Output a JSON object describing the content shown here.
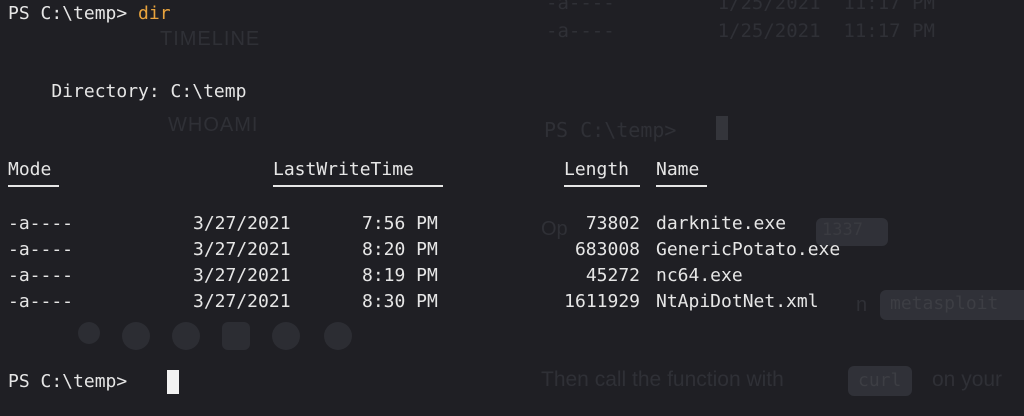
{
  "ghost": {
    "top_row_1": "-a----         1/25/2021  11:17 PM",
    "top_row_2": "-a----         1/25/2021  11:17 PM",
    "timeline": "TIMELINE",
    "whoami": "WHOAMI",
    "prompt": "PS C:\\temp>",
    "op_fragment": "Op",
    "num_fragment": "1337",
    "n_fragment": "n",
    "code_fragment": "metasploit",
    "bottom_text": "Then call the function with",
    "curl": "curl",
    "bottom_tail": "on your"
  },
  "terminal": {
    "prompt_1": "PS C:\\temp> ",
    "command_1": "dir",
    "directory_label": "    Directory: C:\\temp",
    "headers": {
      "mode": "Mode",
      "lastwritetime": "LastWriteTime",
      "length": "Length",
      "name": "Name"
    },
    "rows": [
      {
        "mode": "-a----",
        "date": "3/27/2021",
        "time": "7:56 PM",
        "length": "73802",
        "name": "darknite.exe"
      },
      {
        "mode": "-a----",
        "date": "3/27/2021",
        "time": "8:20 PM",
        "length": "683008",
        "name": "GenericPotato.exe"
      },
      {
        "mode": "-a----",
        "date": "3/27/2021",
        "time": "8:19 PM",
        "length": "45272",
        "name": "nc64.exe"
      },
      {
        "mode": "-a----",
        "date": "3/27/2021",
        "time": "8:30 PM",
        "length": "1611929",
        "name": "NtApiDotNet.xml"
      }
    ],
    "prompt_2": "PS C:\\temp> "
  },
  "colors": {
    "background": "#1f1f24",
    "text": "#e6e6e6",
    "command": "#e8a33d"
  }
}
